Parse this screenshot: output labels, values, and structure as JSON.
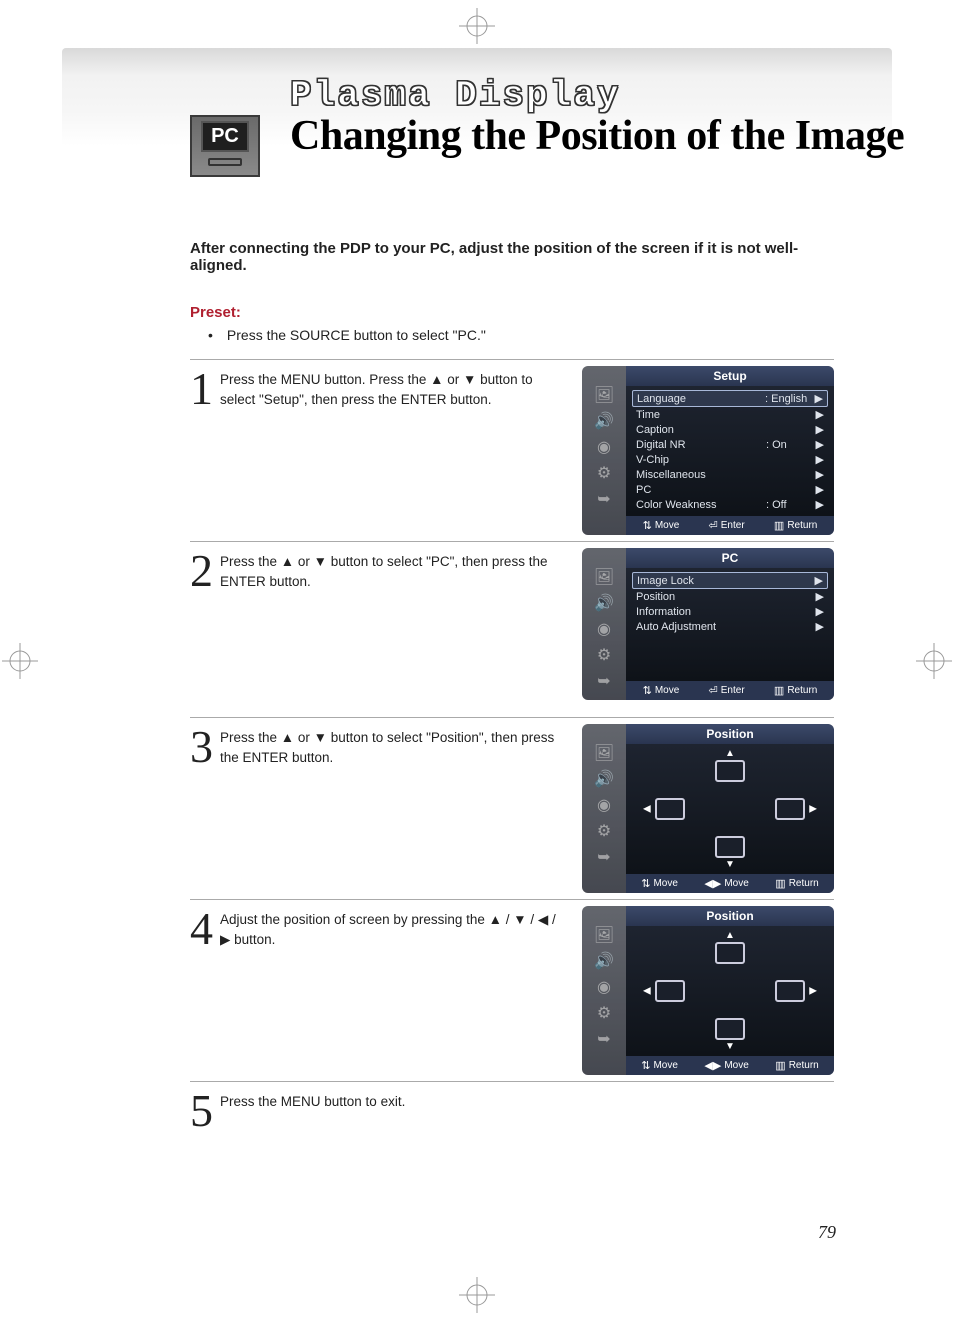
{
  "header": {
    "pc_badge": "PC",
    "small_title": "Plasma Display",
    "large_title": "Changing the Position of the Image"
  },
  "intro": "After connecting the PDP to your PC, adjust the position of the screen if it is not well-aligned.",
  "preset": {
    "heading": "Preset:",
    "item": "Press the SOURCE button to select \"PC.\""
  },
  "steps": {
    "s1": {
      "num": "1",
      "text": "Press the MENU button. Press the ▲ or ▼ button to select \"Setup\", then press the ENTER button."
    },
    "s2": {
      "num": "2",
      "text": "Press the ▲ or ▼ button to select \"PC\", then press the ENTER button."
    },
    "s3": {
      "num": "3",
      "text": "Press the ▲ or ▼ button to select \"Position\", then press the ENTER button."
    },
    "s4": {
      "num": "4",
      "text": "Adjust the position of screen by pressing the ▲ / ▼ / ◀ / ▶ button."
    },
    "s5": {
      "num": "5",
      "text": "Press the MENU button to exit."
    }
  },
  "osd1": {
    "title": "Setup",
    "rows": [
      {
        "label": "Language",
        "value": ":  English",
        "selected": true
      },
      {
        "label": "Time",
        "value": ""
      },
      {
        "label": "Caption",
        "value": ""
      },
      {
        "label": "Digital NR",
        "value": ":  On"
      },
      {
        "label": "V-Chip",
        "value": ""
      },
      {
        "label": "Miscellaneous",
        "value": ""
      },
      {
        "label": "PC",
        "value": ""
      },
      {
        "label": "Color Weakness",
        "value": ":  Off"
      }
    ],
    "footer": {
      "a": "Move",
      "b": "Enter",
      "c": "Return"
    }
  },
  "osd2": {
    "title": "PC",
    "rows": [
      {
        "label": "Image Lock",
        "value": "",
        "selected": true
      },
      {
        "label": "Position",
        "value": ""
      },
      {
        "label": "Information",
        "value": ""
      },
      {
        "label": "Auto Adjustment",
        "value": ""
      }
    ],
    "footer": {
      "a": "Move",
      "b": "Enter",
      "c": "Return"
    }
  },
  "osd3": {
    "title": "Position",
    "footer": {
      "a": "Move",
      "b": "Move",
      "c": "Return"
    }
  },
  "osd4": {
    "title": "Position",
    "footer": {
      "a": "Move",
      "b": "Move",
      "c": "Return"
    }
  },
  "page_number": "79"
}
